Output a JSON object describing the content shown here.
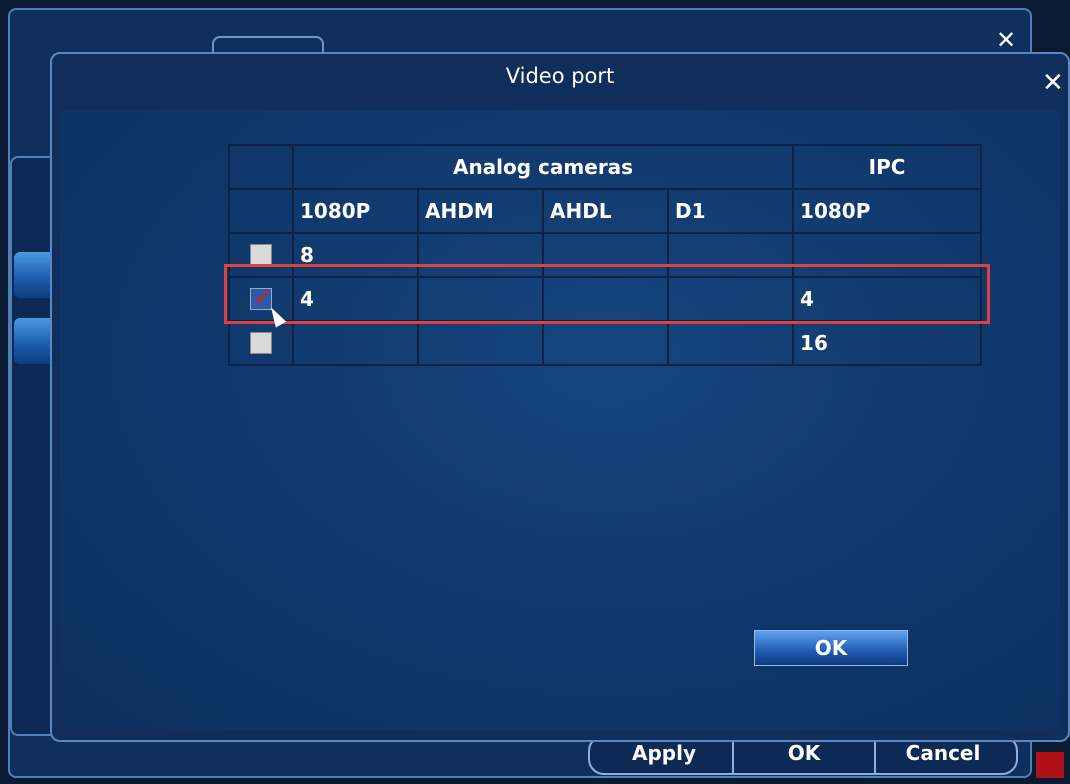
{
  "dialog": {
    "title": "Video port",
    "close_symbol": "✕",
    "ok_label": "OK"
  },
  "table": {
    "group_headers": {
      "analog": "Analog cameras",
      "ipc": "IPC"
    },
    "columns": [
      "1080P",
      "AHDM",
      "AHDL",
      "D1",
      "1080P"
    ],
    "rows": [
      {
        "checked": false,
        "cells": [
          "8",
          "",
          "",
          "",
          ""
        ]
      },
      {
        "checked": true,
        "cells": [
          "4",
          "",
          "",
          "",
          "4"
        ]
      },
      {
        "checked": false,
        "cells": [
          "",
          "",
          "",
          "",
          "16"
        ]
      }
    ]
  },
  "background_window": {
    "close_symbol": "✕",
    "apply_label": "Apply",
    "ok_label": "OK",
    "cancel_label": "Cancel"
  },
  "colors": {
    "dialog_bg": "#0f2e5b",
    "highlight": "#e04040",
    "check_mark": "#d02020"
  }
}
